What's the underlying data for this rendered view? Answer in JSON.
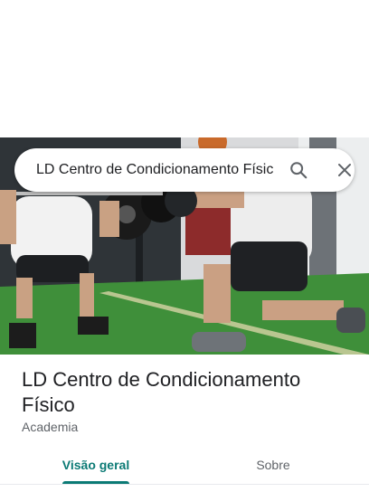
{
  "search": {
    "query": "LD Centro de Condicionamento Físico",
    "search_icon": "search-icon",
    "close_icon": "close-icon"
  },
  "place": {
    "name": "LD Centro de Condicionamento Físico",
    "category": "Academia"
  },
  "tabs": [
    {
      "label": "Visão geral",
      "selected": true
    },
    {
      "label": "Sobre",
      "selected": false
    }
  ],
  "colors": {
    "accent": "#0b7a75",
    "text_primary": "#202124",
    "text_secondary": "#5f6368"
  }
}
